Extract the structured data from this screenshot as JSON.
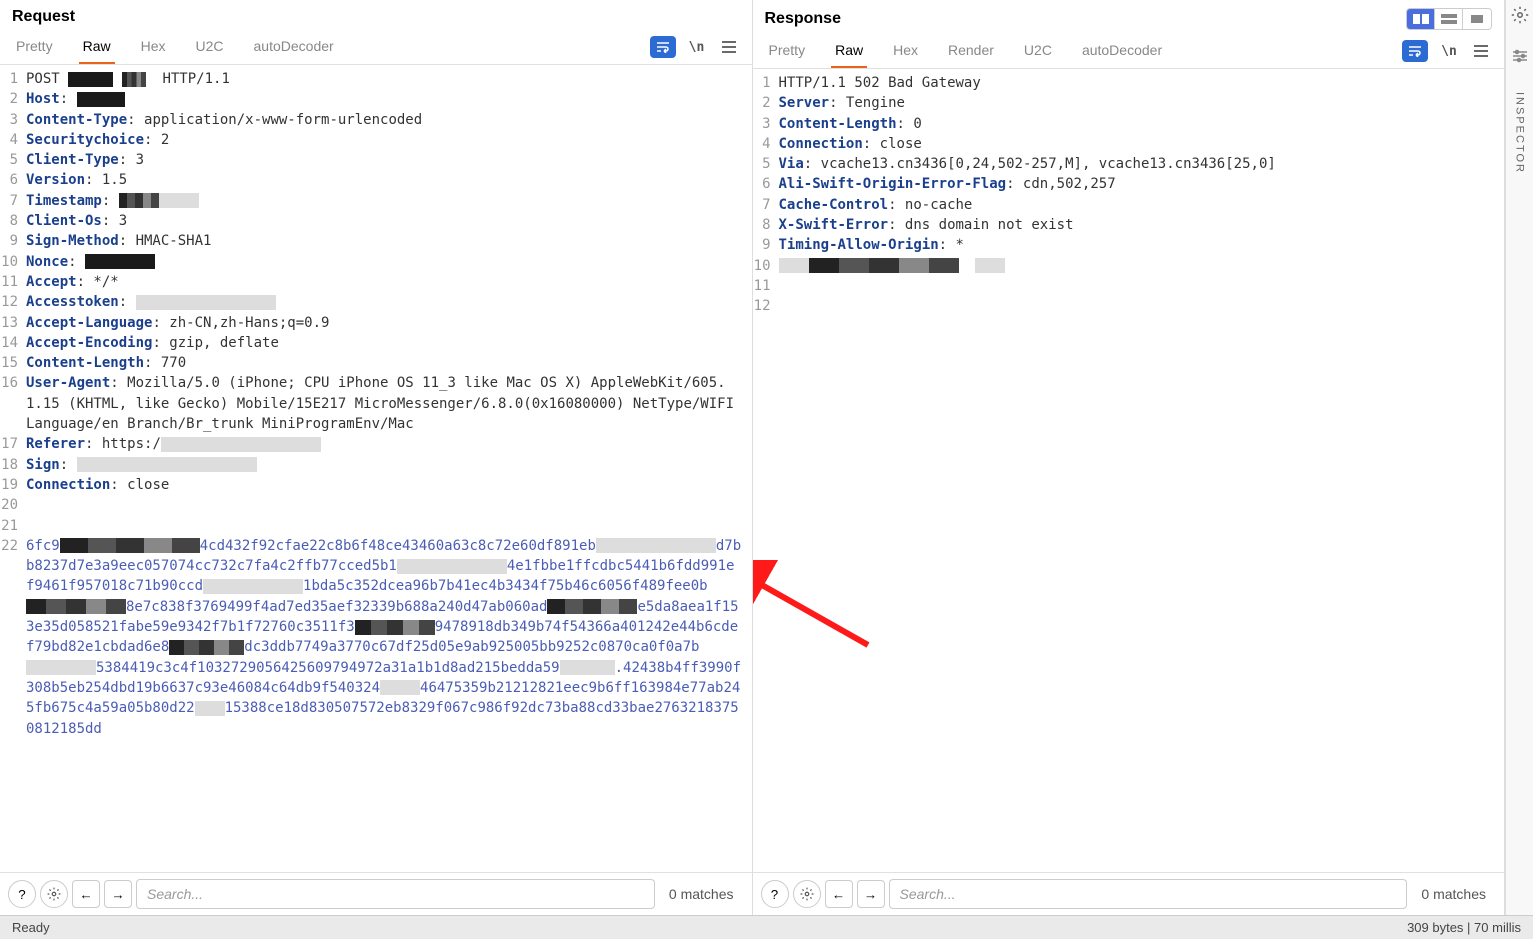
{
  "request": {
    "title": "Request",
    "tabs": [
      "Pretty",
      "Raw",
      "Hex",
      "U2C",
      "autoDecoder"
    ],
    "active_tab": "Raw",
    "lines": [
      {
        "n": 1,
        "parts": [
          {
            "t": "POST ",
            "c": "val"
          },
          {
            "redact": 45
          },
          {
            "t": " ",
            "c": "val"
          },
          {
            "redact": 24,
            "style": "pixelated"
          },
          {
            "t": "  HTTP/1.1",
            "c": "val"
          }
        ]
      },
      {
        "n": 2,
        "parts": [
          {
            "t": "Host",
            "c": "hdr"
          },
          {
            "t": ": ",
            "c": "val"
          },
          {
            "redact": 48
          }
        ]
      },
      {
        "n": 3,
        "parts": [
          {
            "t": "Content-Type",
            "c": "hdr"
          },
          {
            "t": ": application/x-www-form-urlencoded",
            "c": "val"
          }
        ]
      },
      {
        "n": 4,
        "parts": [
          {
            "t": "Securitychoice",
            "c": "hdr"
          },
          {
            "t": ": 2",
            "c": "val"
          }
        ]
      },
      {
        "n": 5,
        "parts": [
          {
            "t": "Client-Type",
            "c": "hdr"
          },
          {
            "t": ": 3",
            "c": "val"
          }
        ]
      },
      {
        "n": 6,
        "parts": [
          {
            "t": "Version",
            "c": "hdr"
          },
          {
            "t": ": 1.5",
            "c": "val"
          }
        ]
      },
      {
        "n": 7,
        "parts": [
          {
            "t": "Timestamp",
            "c": "hdr"
          },
          {
            "t": ": ",
            "c": "val"
          },
          {
            "redact": 40,
            "style": "pixelated"
          },
          {
            "redact": 40,
            "style": "lightgray"
          }
        ]
      },
      {
        "n": 8,
        "parts": [
          {
            "t": "Client-Os",
            "c": "hdr"
          },
          {
            "t": ": 3",
            "c": "val"
          }
        ]
      },
      {
        "n": 9,
        "parts": [
          {
            "t": "Sign-Method",
            "c": "hdr"
          },
          {
            "t": ": HMAC-SHA1",
            "c": "val"
          }
        ]
      },
      {
        "n": 10,
        "parts": [
          {
            "t": "Nonce",
            "c": "hdr"
          },
          {
            "t": ": ",
            "c": "val"
          },
          {
            "redact": 70
          }
        ]
      },
      {
        "n": 11,
        "parts": [
          {
            "t": "Accept",
            "c": "hdr"
          },
          {
            "t": ": */*",
            "c": "val"
          }
        ]
      },
      {
        "n": 12,
        "parts": [
          {
            "t": "Accesstoken",
            "c": "hdr"
          },
          {
            "t": ": ",
            "c": "val"
          },
          {
            "redact": 140,
            "style": "lightgray"
          }
        ]
      },
      {
        "n": 13,
        "parts": [
          {
            "t": "Accept-Language",
            "c": "hdr"
          },
          {
            "t": ": zh-CN,zh-Hans;q=0.9",
            "c": "val"
          }
        ]
      },
      {
        "n": 14,
        "parts": [
          {
            "t": "Accept-Encoding",
            "c": "hdr"
          },
          {
            "t": ": gzip, deflate",
            "c": "val"
          }
        ]
      },
      {
        "n": 15,
        "parts": [
          {
            "t": "Content-Length",
            "c": "hdr"
          },
          {
            "t": ": 770",
            "c": "val"
          }
        ]
      },
      {
        "n": 16,
        "parts": [
          {
            "t": "User-Agent",
            "c": "hdr"
          },
          {
            "t": ": Mozilla/5.0 (iPhone; CPU iPhone OS 11_3 like Mac OS X) AppleWebKit/605.1.15 (KHTML, like Gecko) Mobile/15E217 MicroMessenger/6.8.0(0x16080000) NetType/WIFI Language/en Branch/Br_trunk MiniProgramEnv/Mac",
            "c": "val"
          }
        ]
      },
      {
        "n": 17,
        "parts": [
          {
            "t": "Referer",
            "c": "hdr"
          },
          {
            "t": ": https:/",
            "c": "val"
          },
          {
            "redact": 160,
            "style": "lightgray"
          }
        ]
      },
      {
        "n": 18,
        "parts": [
          {
            "t": "Sign",
            "c": "hdr"
          },
          {
            "t": ": ",
            "c": "val"
          },
          {
            "redact": 180,
            "style": "lightgray"
          }
        ]
      },
      {
        "n": 19,
        "parts": [
          {
            "t": "Connection",
            "c": "hdr"
          },
          {
            "t": ": close",
            "c": "val"
          }
        ]
      },
      {
        "n": 20,
        "parts": []
      },
      {
        "n": 21,
        "parts": []
      },
      {
        "n": 22,
        "parts": [
          {
            "t": "6fc9",
            "c": "body-hex"
          },
          {
            "redact": 140,
            "style": "pixelated"
          },
          {
            "t": "4cd432f92cfae22c8b6f48ce43460a63c8c72e60df891eb",
            "c": "body-hex"
          },
          {
            "redact": 120,
            "style": "lightgray"
          },
          {
            "t": "d7bb8237d7e3a9eec057074cc732c7fa4c2ffb77cced5b1",
            "c": "body-hex"
          },
          {
            "redact": 110,
            "style": "lightgray"
          },
          {
            "t": "4e1fbbe1ffcdbc5441b6fdd991ef9461f957018c71b90ccd",
            "c": "body-hex"
          },
          {
            "redact": 100,
            "style": "lightgray"
          },
          {
            "t": "1bda5c352dcea96b7b41ec4b3434f75b46c6056f489fee0b",
            "c": "body-hex"
          },
          {
            "redact": 100,
            "style": "pixelated"
          },
          {
            "t": "8e7c838f3769499f4ad7ed35aef32339b688a240d47ab060ad",
            "c": "body-hex"
          },
          {
            "redact": 90,
            "style": "pixelated"
          },
          {
            "t": "e5da8aea1f153e35d058521fabe59e9342f7b1f72760c3511f3",
            "c": "body-hex"
          },
          {
            "redact": 80,
            "style": "pixelated"
          },
          {
            "t": "9478918db349b74f54366a401242e44b6cdef79bd82e1cbdad6e8",
            "c": "body-hex"
          },
          {
            "redact": 75,
            "style": "pixelated"
          },
          {
            "t": "dc3ddb7749a3770c67df25d05e9ab925005bb9252c0870ca0f0a7b",
            "c": "body-hex"
          },
          {
            "redact": 70,
            "style": "lightgray"
          },
          {
            "t": "5384419c3c4f1032729056425609794972a31a1b1d8ad215bedda59",
            "c": "body-hex"
          },
          {
            "redact": 55,
            "style": "lightgray"
          },
          {
            "t": ".42438b4ff3990f308b5eb254dbd19b6637c93e46084c64db9f540324",
            "c": "body-hex"
          },
          {
            "redact": 40,
            "style": "lightgray"
          },
          {
            "t": "46475359b21212821eec9b6ff163984e77ab245fb675c4a59a05b80d22",
            "c": "body-hex"
          },
          {
            "redact": 30,
            "style": "lightgray"
          },
          {
            "t": "15388ce18d830507572eb8329f067c986f92dc73ba88cd33bae27632183750812185dd",
            "c": "body-hex"
          }
        ]
      }
    ],
    "search_placeholder": "Search...",
    "matches": "0 matches"
  },
  "response": {
    "title": "Response",
    "tabs": [
      "Pretty",
      "Raw",
      "Hex",
      "Render",
      "U2C",
      "autoDecoder"
    ],
    "active_tab": "Raw",
    "lines": [
      {
        "n": 1,
        "parts": [
          {
            "t": "HTTP/1.1 502 Bad Gateway",
            "c": "val"
          }
        ]
      },
      {
        "n": 2,
        "parts": [
          {
            "t": "Server",
            "c": "hdr"
          },
          {
            "t": ": Tengine",
            "c": "val"
          }
        ]
      },
      {
        "n": 3,
        "parts": [
          {
            "t": "Content-Length",
            "c": "hdr"
          },
          {
            "t": ": 0",
            "c": "val"
          }
        ]
      },
      {
        "n": 4,
        "parts": [
          {
            "t": "Connection",
            "c": "hdr"
          },
          {
            "t": ": close",
            "c": "val"
          }
        ]
      },
      {
        "n": 5,
        "parts": [
          {
            "t": "Via",
            "c": "hdr"
          },
          {
            "t": ": vcache13.cn3436[0,24,502-257,M], vcache13.cn3436[25,0]",
            "c": "val"
          }
        ]
      },
      {
        "n": 6,
        "parts": [
          {
            "t": "Ali-Swift-Origin-Error-Flag",
            "c": "hdr"
          },
          {
            "t": ": cdn,502,257",
            "c": "val"
          }
        ]
      },
      {
        "n": 7,
        "parts": [
          {
            "t": "Cache-Control",
            "c": "hdr"
          },
          {
            "t": ": no-cache",
            "c": "val"
          }
        ]
      },
      {
        "n": 8,
        "parts": [
          {
            "t": "X-Swift-Error",
            "c": "hdr"
          },
          {
            "t": ": dns domain not exist",
            "c": "val"
          }
        ]
      },
      {
        "n": 9,
        "parts": [
          {
            "t": "Timing-Allow-Origin",
            "c": "hdr"
          },
          {
            "t": ": *",
            "c": "val"
          }
        ]
      },
      {
        "n": 10,
        "parts": [
          {
            "redact": 30,
            "style": "lightgray"
          },
          {
            "redact": 150,
            "style": "pixelated"
          },
          {
            "t": "  ",
            "c": "val"
          },
          {
            "redact": 30,
            "style": "lightgray"
          }
        ]
      },
      {
        "n": 11,
        "parts": []
      },
      {
        "n": 12,
        "parts": []
      }
    ],
    "search_placeholder": "Search...",
    "matches": "0 matches"
  },
  "inspector_label": "INSPECTOR",
  "status": {
    "left": "Ready",
    "right": "309 bytes | 70 millis"
  },
  "newline_label": "\\n"
}
